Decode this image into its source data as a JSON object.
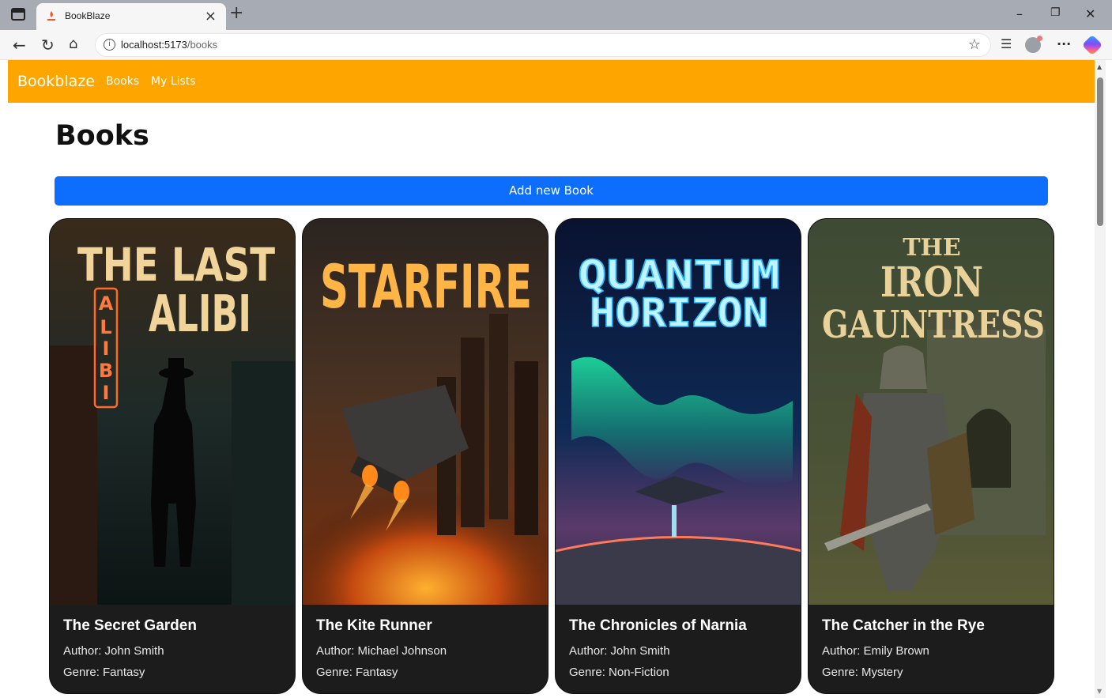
{
  "browser": {
    "tab_title": "BookBlaze",
    "url_host": "localhost:5173",
    "url_path": "/books"
  },
  "navbar": {
    "brand": "Bookblaze",
    "links": [
      "Books",
      "My Lists"
    ],
    "color": "#ffa500"
  },
  "page": {
    "title": "Books",
    "add_button": "Add new Book",
    "button_color": "#0d6efd"
  },
  "books": [
    {
      "cover_text": [
        "THE LAST",
        "ALIBI"
      ],
      "cover_sign": "ALIBI",
      "title": "The Secret Garden",
      "author": "Author: John Smith",
      "genre": "Genre: Fantasy"
    },
    {
      "cover_text": [
        "STARFIRE"
      ],
      "title": "The Kite Runner",
      "author": "Author: Michael Johnson",
      "genre": "Genre: Fantasy"
    },
    {
      "cover_text": [
        "QUANTUM",
        "HORIZON"
      ],
      "title": "The Chronicles of Narnia",
      "author": "Author: John Smith",
      "genre": "Genre: Non-Fiction"
    },
    {
      "cover_text": [
        "THE",
        "IRON",
        "GAUNTRESS"
      ],
      "title": "The Catcher in the Rye",
      "author": "Author: Emily Brown",
      "genre": "Genre: Mystery"
    }
  ]
}
